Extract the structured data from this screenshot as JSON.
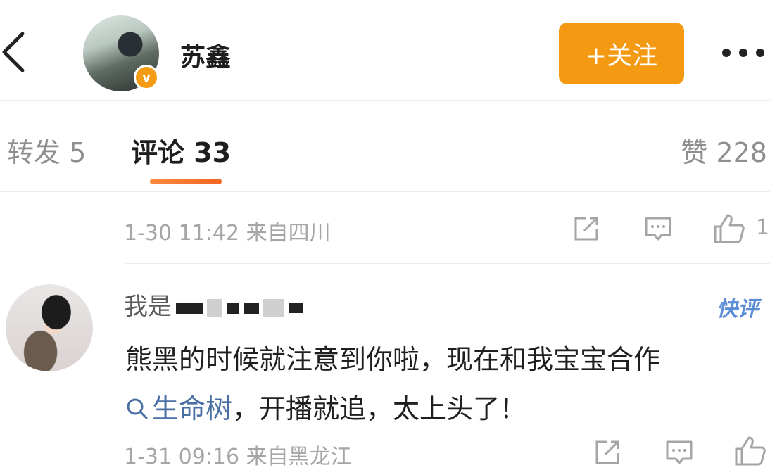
{
  "header": {
    "user_name": "苏鑫",
    "verified_badge": "v",
    "follow_label": "+关注",
    "brand_color": "#f49a12"
  },
  "tabs": {
    "repost": "转发 5",
    "comment": "评论 33",
    "likes": "赞 228"
  },
  "post_meta": {
    "time_location": "1-30 11:42 来自四川",
    "like_count": "1"
  },
  "comment": {
    "user_name_prefix": "我是",
    "quick_badge": "快评",
    "line1": "熊黑的时候就注意到你啦，现在和我宝宝合作",
    "topic_tag": "生命树",
    "line2_rest": "，开播就追，太上头了！",
    "time_location": "1-31 09:16 来自黑龙江"
  },
  "icons": [
    "back-icon",
    "more-icon",
    "repost-icon",
    "comment-icon",
    "like-icon",
    "search-icon"
  ]
}
